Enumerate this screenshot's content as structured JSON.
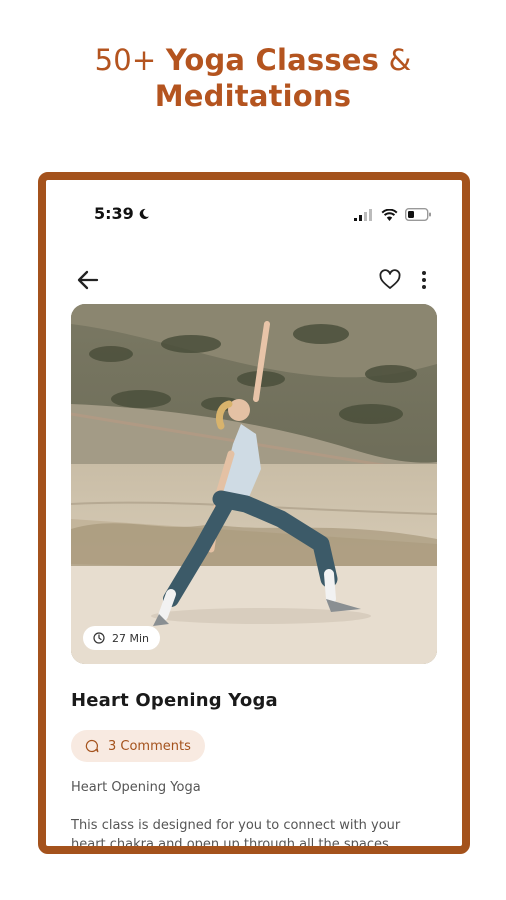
{
  "headline": {
    "prefix": "50+ ",
    "highlight_1": "Yoga Classes",
    "connector": " & ",
    "highlight_2": "Meditations"
  },
  "status_bar": {
    "time": "5:39",
    "icons": [
      "moon-icon",
      "signal-icon",
      "wifi-icon",
      "battery-icon"
    ]
  },
  "nav": {
    "icons": [
      "back-arrow-icon",
      "heart-icon",
      "more-vertical-icon"
    ]
  },
  "hero": {
    "duration": "27 Min",
    "duration_icon": "clock-icon"
  },
  "class": {
    "title": "Heart Opening Yoga",
    "comments": "3 Comments",
    "comments_icon": "comment-icon",
    "subtitle": "Heart Opening Yoga",
    "description": "This class is designed for you to connect with your heart chakra and open up through all the spaces"
  },
  "colors": {
    "accent": "#a4521c",
    "headline": "#b4541f",
    "chip_bg": "#f8eae1"
  }
}
